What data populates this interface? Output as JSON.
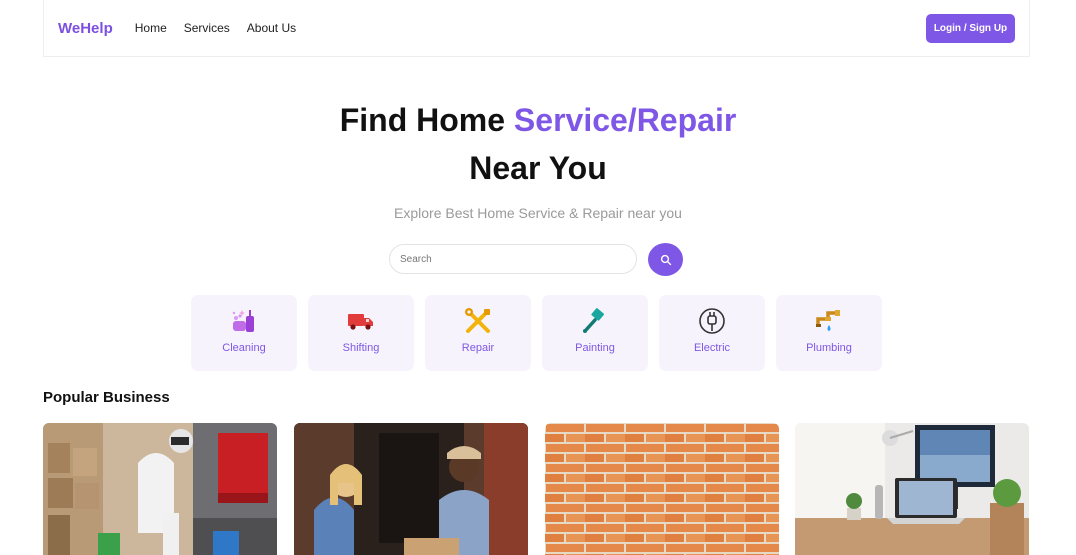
{
  "nav": {
    "logo": "WeHelp",
    "links": [
      "Home",
      "Services",
      "About Us"
    ],
    "login_label": "Login / Sign Up"
  },
  "hero": {
    "title_part1": "Find Home ",
    "title_accent": "Service/Repair",
    "title_line2": "Near You",
    "subtitle": "Explore Best Home Service & Repair near you"
  },
  "search": {
    "placeholder": "Search"
  },
  "categories": [
    {
      "label": "Cleaning",
      "icon": "cleaning-icon"
    },
    {
      "label": "Shifting",
      "icon": "truck-icon"
    },
    {
      "label": "Repair",
      "icon": "tools-icon"
    },
    {
      "label": "Painting",
      "icon": "paintbrush-icon"
    },
    {
      "label": "Electric",
      "icon": "plug-icon"
    },
    {
      "label": "Plumbing",
      "icon": "faucet-icon"
    }
  ],
  "popular": {
    "title": "Popular Business"
  },
  "colors": {
    "accent": "#7f57e6",
    "category_bg": "#f6f3fc"
  }
}
